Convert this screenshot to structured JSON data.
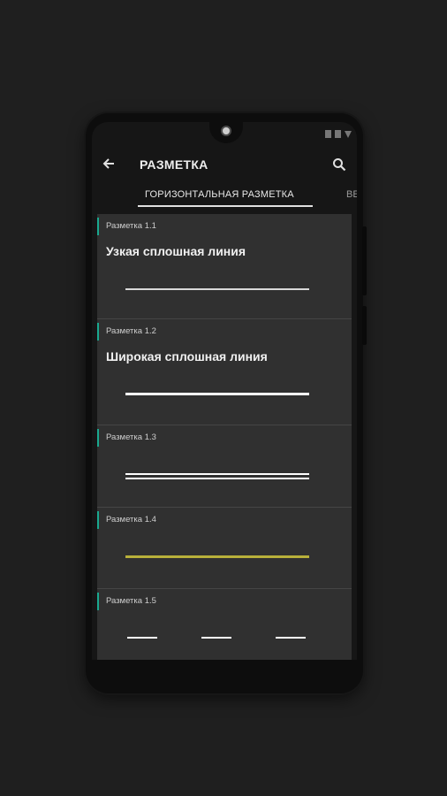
{
  "appbar": {
    "title": "РАЗМЕТКА"
  },
  "tabs": [
    {
      "label": "ГОРИЗОНТАЛЬНАЯ РАЗМЕТКА"
    },
    {
      "label": "ВЕ"
    }
  ],
  "items": [
    {
      "code": "Разметка 1.1",
      "name": "Узкая сплошная линия",
      "line_style": "narrow-solid",
      "line_color": "#d9d9d9"
    },
    {
      "code": "Разметка 1.2",
      "name": "Широкая сплошная линия",
      "line_style": "wide-solid",
      "line_color": "#ffffff"
    },
    {
      "code": "Разметка 1.3",
      "name": "",
      "line_style": "double-solid",
      "line_color": "#ffffff"
    },
    {
      "code": "Разметка 1.4",
      "name": "",
      "line_style": "yellow-solid",
      "line_color": "#b8b03a"
    },
    {
      "code": "Разметка 1.5",
      "name": "",
      "line_style": "dashed",
      "line_color": "#ffffff"
    }
  ],
  "colors": {
    "accent": "#1aa88f",
    "background": "#1f1f1f",
    "card": "#303030"
  },
  "icons": {
    "back": "arrow-left-icon",
    "search": "search-icon"
  }
}
